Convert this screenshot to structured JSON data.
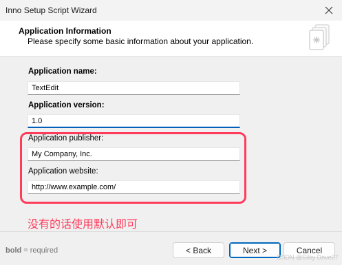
{
  "window": {
    "title": "Inno Setup Script Wizard"
  },
  "header": {
    "title": "Application Information",
    "subtitle": "Please specify some basic information about your application."
  },
  "form": {
    "app_name": {
      "label": "Application name:",
      "value": "TextEdit",
      "required": true
    },
    "app_version": {
      "label": "Application version:",
      "value": "1.0",
      "required": true
    },
    "app_publisher": {
      "label": "Application publisher:",
      "value": "My Company, Inc.",
      "required": false
    },
    "app_website": {
      "label": "Application website:",
      "value": "http://www.example.com/",
      "required": false
    }
  },
  "annotation": {
    "text": "没有的话使用默认即可",
    "color": "#ff3b5c"
  },
  "footer": {
    "required_bold": "bold",
    "required_rest": " = required",
    "back_label": "< Back",
    "next_label": "Next >",
    "cancel_label": "Cancel"
  },
  "watermark": "CSDN @Silky Dove07",
  "colors": {
    "accent": "#0067c0",
    "highlight": "#ff3b5c"
  },
  "icons": {
    "close": "close-icon",
    "logo": "wizard-setup-icon"
  }
}
